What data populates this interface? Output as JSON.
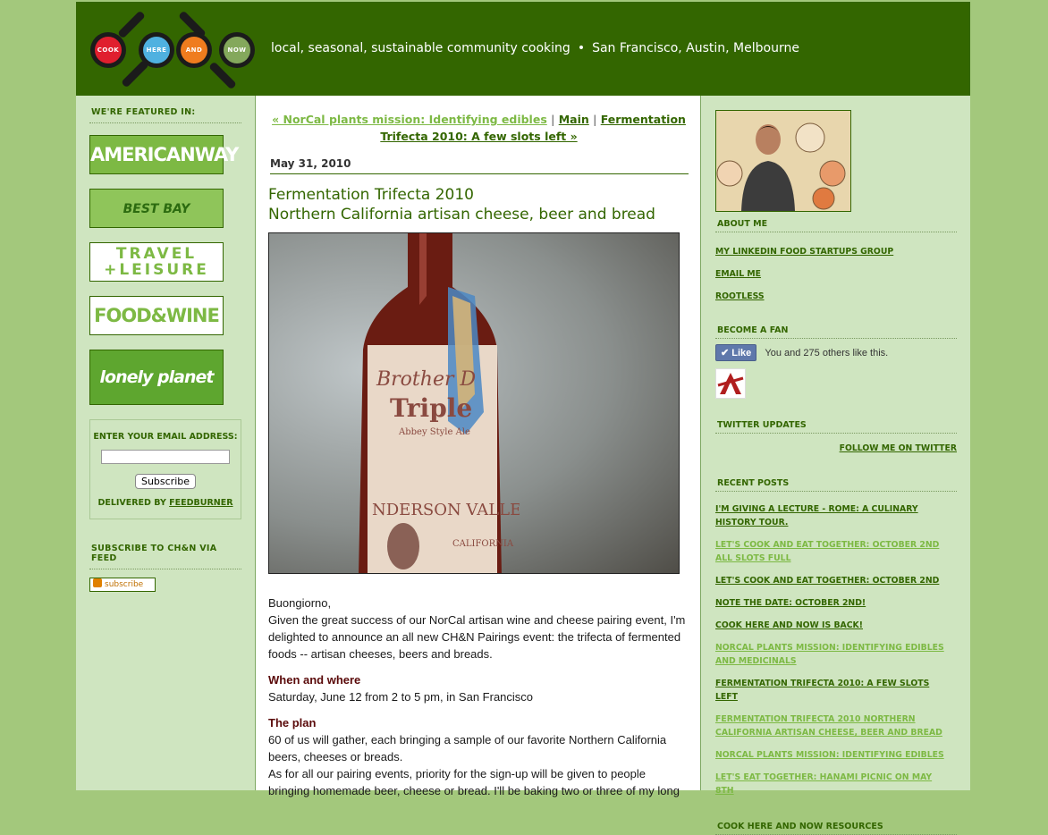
{
  "header": {
    "pans": [
      {
        "label": "COOK",
        "color": "#e01f2e"
      },
      {
        "label": "HERE",
        "color": "#4fb1e0"
      },
      {
        "label": "AND",
        "color": "#ef7c1e"
      },
      {
        "label": "NOW",
        "color": "#84a85c"
      }
    ],
    "tagline_left": "local, seasonal, sustainable community cooking",
    "tagline_sep": "•",
    "tagline_right": "San Francisco, Austin, Melbourne"
  },
  "left": {
    "featured_heading": "We're featured in:",
    "features": [
      "AMERICANWAY",
      "BEST BAY",
      "TRAVEL +LEISURE",
      "FOOD&WINE",
      "lonely planet"
    ],
    "email_label": "Enter your email address:",
    "subscribe_button": "Subscribe",
    "delivered_by": "Delivered by",
    "feedburner": "FeedBurner",
    "feed_heading": "Subscribe to CH&N via feed",
    "rss_label": "subscribe"
  },
  "main": {
    "nav_prev": "« NorCal plants mission: Identifying edibles",
    "nav_sep": "|",
    "nav_main": "Main",
    "nav_next": "Fermentation Trifecta 2010: A few slots left »",
    "date": "May 31, 2010",
    "title_line1": "Fermentation Trifecta 2010",
    "title_line2": "Northern California artisan cheese, beer and bread",
    "greeting": "Buongiorno,",
    "intro": "Given the great success of our NorCal artisan wine and cheese pairing event, I'm delighted to announce an all new CH&N Pairings event: the trifecta of fermented foods -- artisan cheeses, beers and breads.",
    "when_heading": "When and where",
    "when_text": "Saturday, June 12 from 2 to 5 pm, in San Francisco",
    "plan_heading": "The plan",
    "plan_text": "60 of us will gather, each bringing a sample of our favorite Northern California beers, cheeses or breads.",
    "priority_text": "As for all our pairing events, priority for the sign-up will be given to people bringing homemade beer, cheese or bread. I'll be baking two or three of my long"
  },
  "right": {
    "about_heading": "About Me",
    "about_links": [
      "My LinkedIn Food Startups Group",
      "Email me",
      "Rootless"
    ],
    "fan_heading": "Become a Fan",
    "like_label": "Like",
    "like_text": "You and 275 others like this.",
    "twitter_heading": "Twitter Updates",
    "follow_twitter": "follow me on Twitter",
    "recent_heading": "Recent Posts",
    "recent_posts": [
      {
        "text": "I'm giving a lecture - Rome: A Culinary History Tour.",
        "light": false
      },
      {
        "text": "Let's Cook and Eat Together: October 2nd all slots full",
        "light": true
      },
      {
        "text": "Let's Cook and Eat Together: October 2nd",
        "light": false
      },
      {
        "text": "Note the date: October 2nd!",
        "light": false
      },
      {
        "text": "Cook Here and Now is back!",
        "light": false
      },
      {
        "text": "NorCal plants mission: Identifying edibles and medicinals",
        "light": true
      },
      {
        "text": "Fermentation Trifecta 2010: A few slots left",
        "light": false
      },
      {
        "text": "Fermentation Trifecta 2010 Northern California artisan cheese, beer and bread",
        "light": true
      },
      {
        "text": "NorCal plants mission: Identifying edibles",
        "light": true
      },
      {
        "text": "Let's eat together: Hanami picnic on May 8th",
        "light": true
      }
    ],
    "resources_heading": "Cook Here and Now Resources"
  }
}
